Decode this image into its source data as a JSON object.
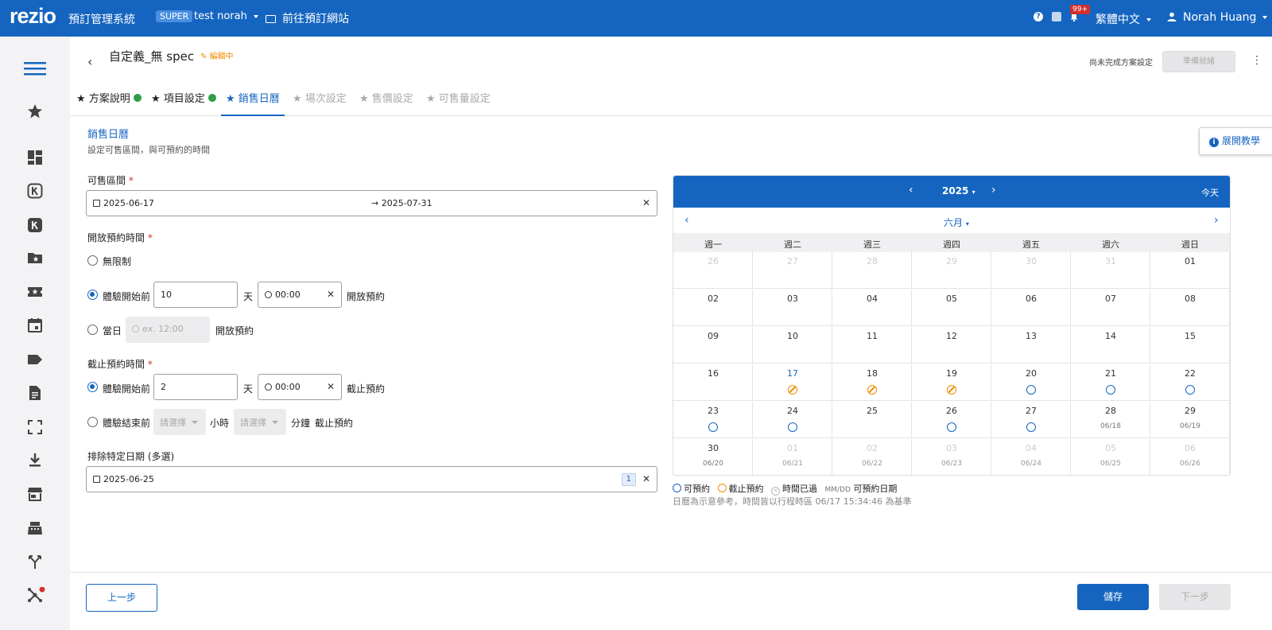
{
  "app": {
    "logo": "rezio",
    "system_name": "預訂管理系統",
    "role_badge": "SUPER",
    "account": "test norah",
    "goto_site": "前往預訂網站",
    "notif_count": "99+",
    "language": "繁體中文",
    "user_name": "Norah Huang"
  },
  "sidebar": {
    "items": [
      "menu-icon",
      "star-icon",
      "dashboard-icon",
      "k-outline-icon",
      "k-filled-icon",
      "folder-star-icon",
      "ticket-star-icon",
      "calendar-icon",
      "tag-icon",
      "document-icon",
      "fullscreen-icon",
      "download-icon",
      "store-icon",
      "register-icon",
      "fork-icon",
      "network-icon"
    ]
  },
  "header": {
    "title": "自定義_無 spec",
    "status": "編輯中",
    "incomplete_text": "尚未完成方案設定",
    "ready_label": "準備就緒"
  },
  "tabs": [
    {
      "label": "方案說明",
      "state": "done"
    },
    {
      "label": "項目設定",
      "state": "done"
    },
    {
      "label": "銷售日曆",
      "state": "active"
    },
    {
      "label": "場次設定",
      "state": "disabled"
    },
    {
      "label": "售價設定",
      "state": "disabled"
    },
    {
      "label": "可售量設定",
      "state": "disabled"
    }
  ],
  "section": {
    "title": "銷售日曆",
    "subtitle": "設定可售區間，與可預約的時間",
    "tutorial_label": "展開教學"
  },
  "sale_period": {
    "label": "可售區間",
    "required": "*",
    "start": "2025-06-17",
    "arrow": "→",
    "end": "2025-07-31"
  },
  "open_time": {
    "label": "開放預約時間",
    "required": "*",
    "opt_unlimited": "無限制",
    "opt_before": "體驗開始前",
    "days_value": "10",
    "days_unit": "天",
    "time_value": "00:00",
    "suffix": "開放預約",
    "opt_sameday": "當日",
    "sameday_placeholder": "ex. 12:00",
    "sameday_suffix": "開放預約"
  },
  "close_time": {
    "label": "截止預約時間",
    "required": "*",
    "opt_before": "體驗開始前",
    "days_value": "2",
    "days_unit": "天",
    "time_value": "00:00",
    "suffix": "截止預約",
    "opt_after": "體驗結束前",
    "hour_placeholder": "請選擇",
    "hour_unit": "小時",
    "min_placeholder": "請選擇",
    "min_unit": "分鐘",
    "after_suffix": "截止預約"
  },
  "exclude": {
    "label": "排除特定日期 (多選)",
    "value": "2025-06-25",
    "count": "1"
  },
  "calendar": {
    "year": "2025",
    "month": "六月",
    "today_label": "今天",
    "weekdays": [
      "週一",
      "週二",
      "週三",
      "週四",
      "週五",
      "週六",
      "週日"
    ],
    "weeks": [
      [
        {
          "d": "26",
          "o": true
        },
        {
          "d": "27",
          "o": true
        },
        {
          "d": "28",
          "o": true
        },
        {
          "d": "29",
          "o": true
        },
        {
          "d": "30",
          "o": true
        },
        {
          "d": "31",
          "o": true
        },
        {
          "d": "01"
        }
      ],
      [
        {
          "d": "02"
        },
        {
          "d": "03"
        },
        {
          "d": "04"
        },
        {
          "d": "05"
        },
        {
          "d": "06"
        },
        {
          "d": "07"
        },
        {
          "d": "08"
        }
      ],
      [
        {
          "d": "09"
        },
        {
          "d": "10"
        },
        {
          "d": "11"
        },
        {
          "d": "12"
        },
        {
          "d": "13"
        },
        {
          "d": "14"
        },
        {
          "d": "15"
        }
      ],
      [
        {
          "d": "16"
        },
        {
          "d": "17",
          "cur": true,
          "m": "closed"
        },
        {
          "d": "18",
          "m": "closed"
        },
        {
          "d": "19",
          "m": "closed"
        },
        {
          "d": "20",
          "m": "open"
        },
        {
          "d": "21",
          "m": "open"
        },
        {
          "d": "22",
          "m": "open"
        }
      ],
      [
        {
          "d": "23",
          "m": "open"
        },
        {
          "d": "24",
          "m": "open"
        },
        {
          "d": "25"
        },
        {
          "d": "26",
          "m": "open"
        },
        {
          "d": "27",
          "m": "open"
        },
        {
          "d": "28",
          "s": "06/18"
        },
        {
          "d": "29",
          "s": "06/19"
        }
      ],
      [
        {
          "d": "30",
          "s": "06/20"
        },
        {
          "d": "01",
          "o": true,
          "s": "06/21"
        },
        {
          "d": "02",
          "o": true,
          "s": "06/22"
        },
        {
          "d": "03",
          "o": true,
          "s": "06/23"
        },
        {
          "d": "04",
          "o": true,
          "s": "06/24"
        },
        {
          "d": "05",
          "o": true,
          "s": "06/25"
        },
        {
          "d": "06",
          "o": true,
          "s": "06/26"
        }
      ]
    ],
    "legend": {
      "open": "可預約",
      "closed": "截止預約",
      "past": "時間已過",
      "mmdd": "MM/DD",
      "mmdd_text": "可預約日期"
    },
    "note": "日曆為示意參考，時間皆以行程時區 06/17 15:34:46 為基準"
  },
  "footer": {
    "prev": "上一步",
    "save": "儲存",
    "next": "下一步"
  },
  "colors": {
    "primary": "#1565c0",
    "warning": "#f08c00",
    "success": "#2e9e47",
    "danger": "#d32f2f"
  }
}
